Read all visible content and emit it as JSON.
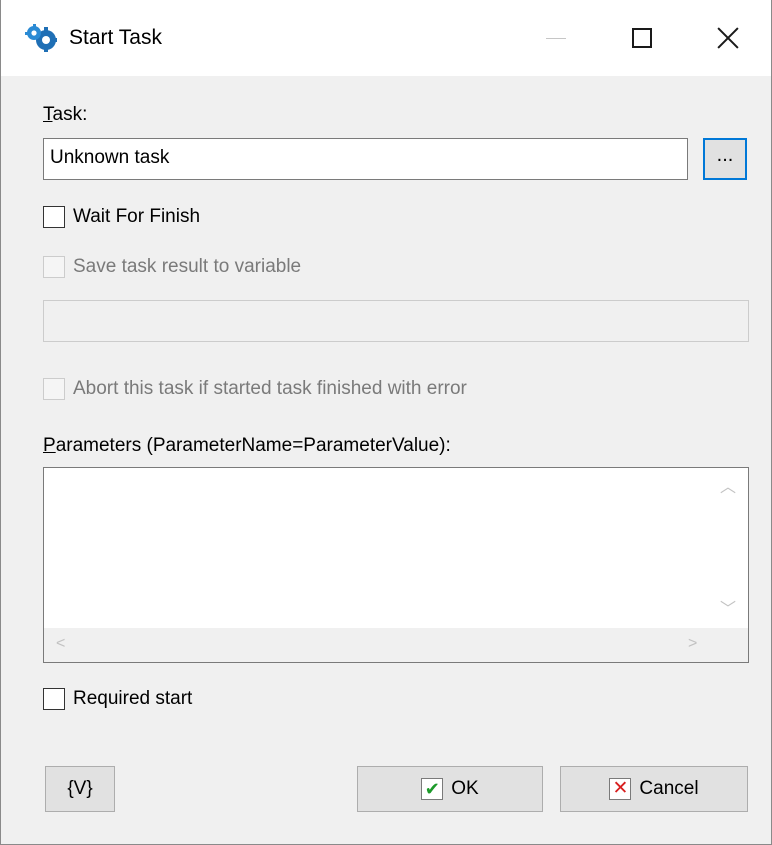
{
  "window": {
    "title": "Start Task",
    "app_icon": "gears-icon"
  },
  "task": {
    "label_accel": "T",
    "label_rest": "ask:",
    "value": "Unknown task",
    "browse_label": "..."
  },
  "wait_for_finish": {
    "label": "Wait For Finish",
    "checked": false
  },
  "save_result": {
    "label": "Save task result to variable",
    "checked": false,
    "enabled": false,
    "variable_value": ""
  },
  "abort_on_error": {
    "label": "Abort this task if started task finished with error",
    "checked": false,
    "enabled": false
  },
  "parameters": {
    "label_accel": "P",
    "label_rest": "arameters (ParameterName=ParameterValue):",
    "value": ""
  },
  "required_start": {
    "label": "Required start",
    "checked": false
  },
  "buttons": {
    "variables_label": "{V}",
    "ok_label": "OK",
    "cancel_label": "Cancel"
  },
  "colors": {
    "accent": "#0078d7",
    "ok_check": "#1d9a2a",
    "cancel_x": "#d81f1f"
  }
}
